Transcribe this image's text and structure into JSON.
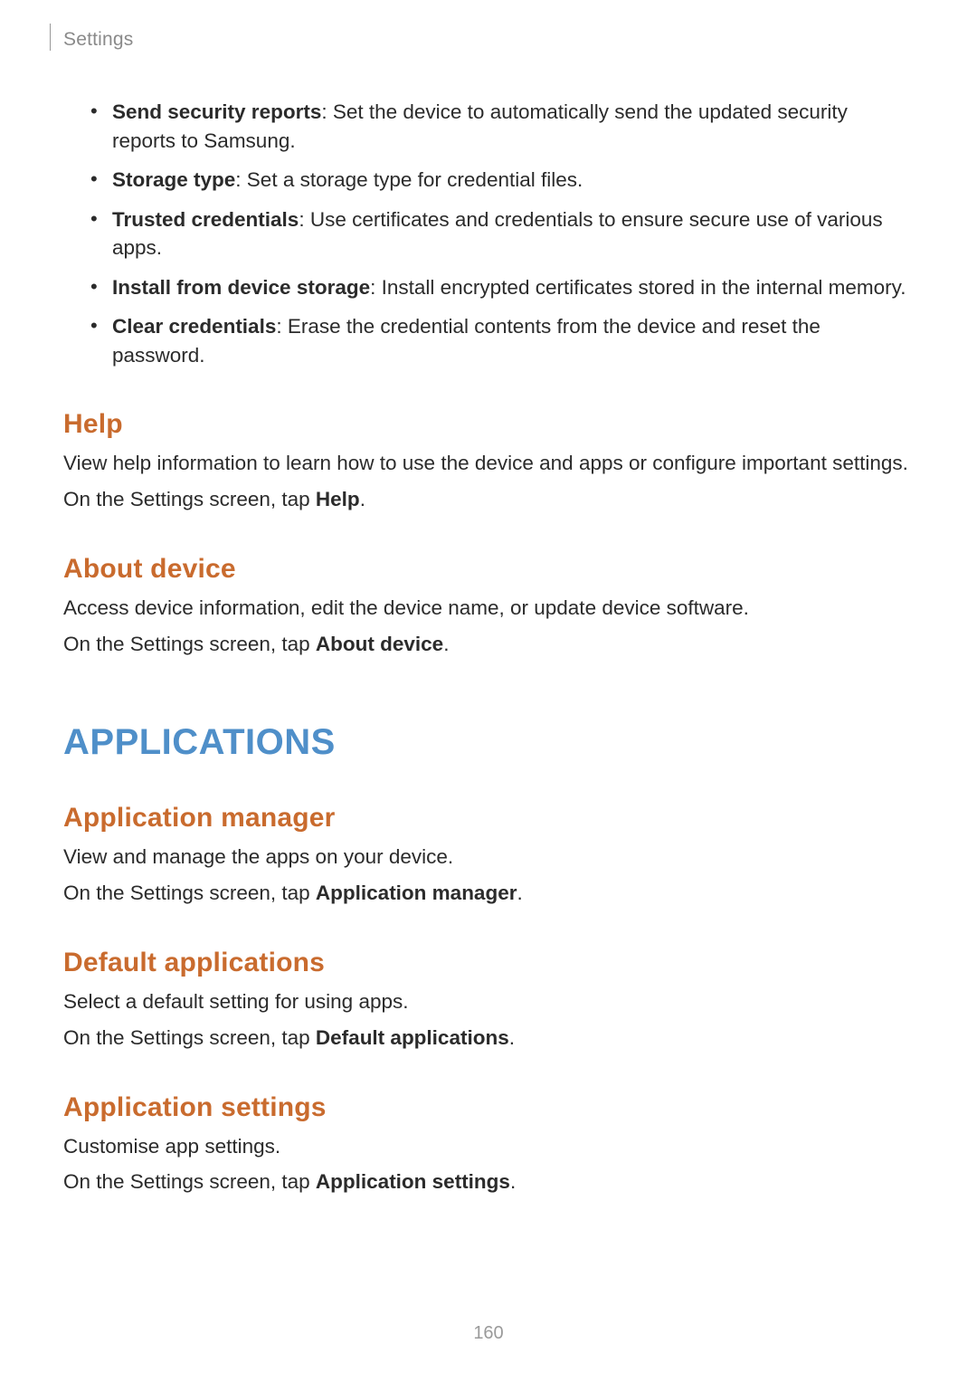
{
  "header": {
    "label": "Settings"
  },
  "page_number": "160",
  "bullets": [
    {
      "term": "Send security reports",
      "desc": ": Set the device to automatically send the updated security reports to Samsung."
    },
    {
      "term": "Storage type",
      "desc": ": Set a storage type for credential files."
    },
    {
      "term": "Trusted credentials",
      "desc": ": Use certificates and credentials to ensure secure use of various apps."
    },
    {
      "term": "Install from device storage",
      "desc": ": Install encrypted certificates stored in the internal memory."
    },
    {
      "term": "Clear credentials",
      "desc": ": Erase the credential contents from the device and reset the password."
    }
  ],
  "help": {
    "title": "Help",
    "body": "View help information to learn how to use the device and apps or configure important settings.",
    "instr_prefix": "On the Settings screen, tap ",
    "instr_bold": "Help",
    "instr_suffix": "."
  },
  "about": {
    "title": "About device",
    "body": "Access device information, edit the device name, or update device software.",
    "instr_prefix": "On the Settings screen, tap ",
    "instr_bold": "About device",
    "instr_suffix": "."
  },
  "chapter": {
    "title": "APPLICATIONS"
  },
  "appmgr": {
    "title": "Application manager",
    "body": "View and manage the apps on your device.",
    "instr_prefix": "On the Settings screen, tap ",
    "instr_bold": "Application manager",
    "instr_suffix": "."
  },
  "defapps": {
    "title": "Default applications",
    "body": "Select a default setting for using apps.",
    "instr_prefix": "On the Settings screen, tap ",
    "instr_bold": "Default applications",
    "instr_suffix": "."
  },
  "appset": {
    "title": "Application settings",
    "body": "Customise app settings.",
    "instr_prefix": "On the Settings screen, tap ",
    "instr_bold": "Application settings",
    "instr_suffix": "."
  }
}
